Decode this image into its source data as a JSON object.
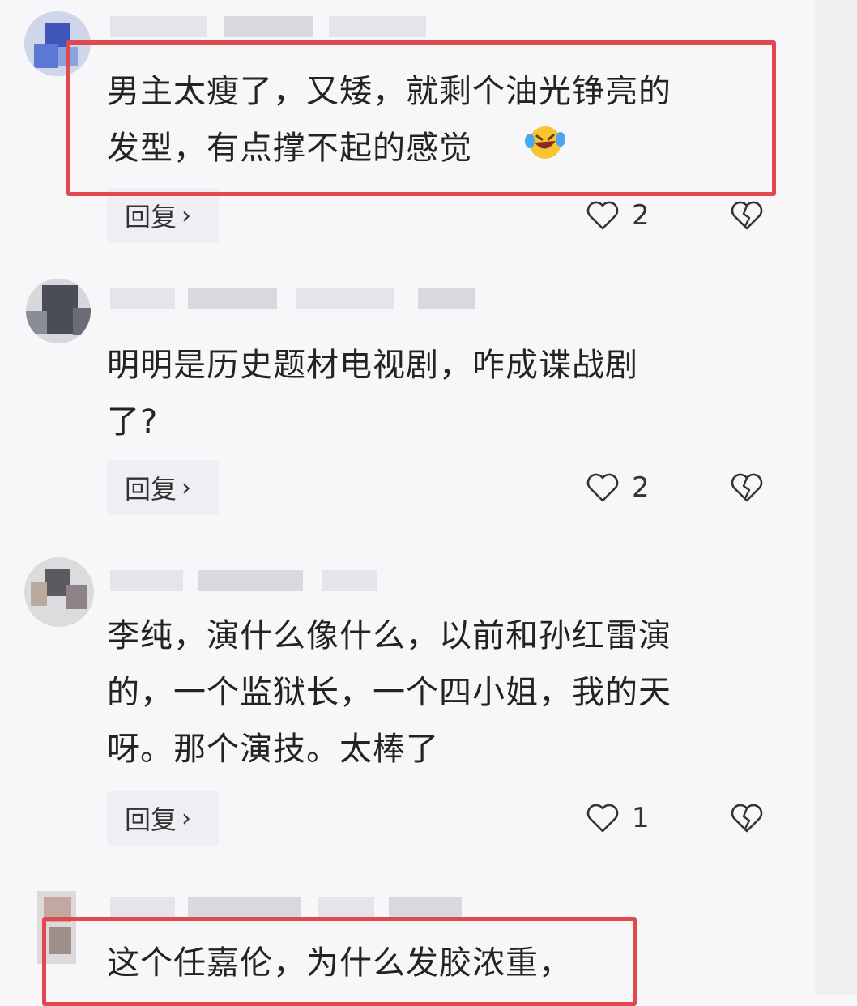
{
  "comments": [
    {
      "text": "男主太瘦了，又矮，就剩个油光铮亮的\n发型，有点撑不起的感觉",
      "emoji": "laughing-crying-emoji",
      "reply_label": "回复",
      "likes": "2"
    },
    {
      "text": "明明是历史题材电视剧，咋成谍战剧\n了?",
      "reply_label": "回复",
      "likes": "2"
    },
    {
      "text": "李纯，演什么像什么，以前和孙红雷演\n的，一个监狱长，一个四小姐，我的天\n呀。那个演技。太棒了",
      "reply_label": "回复",
      "likes": "1"
    },
    {
      "text": "这个任嘉伦，为什么发胶浓重，"
    }
  ],
  "icons": {
    "like": "heart-outline-icon",
    "dislike": "broken-heart-icon",
    "reply_arrow": "chevron-right-icon"
  },
  "colors": {
    "highlight": "#e04a4f",
    "background": "#f7f7fa"
  }
}
